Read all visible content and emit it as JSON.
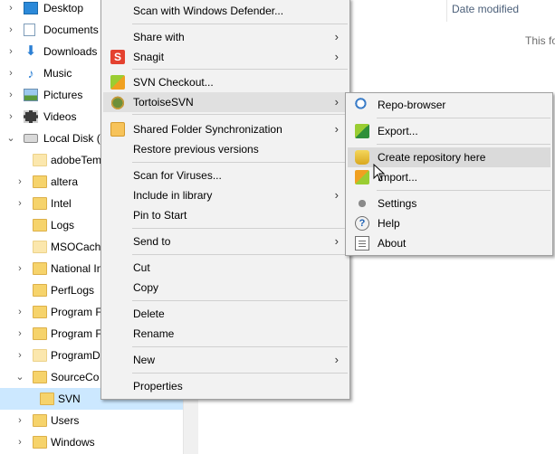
{
  "nav_tree": {
    "items": [
      {
        "label": "Desktop",
        "icon": "desktop-icon",
        "chevron": "›",
        "indent": 0
      },
      {
        "label": "Documents",
        "icon": "documents-icon",
        "chevron": "›",
        "indent": 0
      },
      {
        "label": "Downloads",
        "icon": "downloads-icon",
        "chevron": "›",
        "indent": 0
      },
      {
        "label": "Music",
        "icon": "music-icon",
        "chevron": "›",
        "indent": 0
      },
      {
        "label": "Pictures",
        "icon": "pictures-icon",
        "chevron": "›",
        "indent": 0
      },
      {
        "label": "Videos",
        "icon": "videos-icon",
        "chevron": "›",
        "indent": 0
      },
      {
        "label": "Local Disk (C",
        "icon": "drive-icon",
        "chevron": "⌄",
        "indent": 0
      },
      {
        "label": "adobeTem",
        "icon": "folder-icon",
        "chevron": "",
        "indent": 1
      },
      {
        "label": "altera",
        "icon": "folder-icon",
        "chevron": "›",
        "indent": 1
      },
      {
        "label": "Intel",
        "icon": "folder-icon",
        "chevron": "›",
        "indent": 1
      },
      {
        "label": "Logs",
        "icon": "folder-icon",
        "chevron": "",
        "indent": 1
      },
      {
        "label": "MSOCache",
        "icon": "folder-icon",
        "chevron": "",
        "indent": 1
      },
      {
        "label": "National In",
        "icon": "folder-icon",
        "chevron": "›",
        "indent": 1
      },
      {
        "label": "PerfLogs",
        "icon": "folder-icon",
        "chevron": "",
        "indent": 1
      },
      {
        "label": "Program F",
        "icon": "folder-icon",
        "chevron": "›",
        "indent": 1
      },
      {
        "label": "Program F",
        "icon": "folder-icon",
        "chevron": "›",
        "indent": 1
      },
      {
        "label": "ProgramD",
        "icon": "folder-icon",
        "chevron": "›",
        "indent": 1
      },
      {
        "label": "SourceCo",
        "icon": "folder-icon",
        "chevron": "⌄",
        "indent": 1
      },
      {
        "label": "SVN",
        "icon": "folder-icon",
        "chevron": "",
        "indent": 2
      },
      {
        "label": "Users",
        "icon": "folder-icon",
        "chevron": "›",
        "indent": 1
      },
      {
        "label": "Windows",
        "icon": "folder-icon",
        "chevron": "›",
        "indent": 1
      }
    ]
  },
  "details": {
    "column_date_modified": "Date modified",
    "empty_message": "This fo"
  },
  "context_menu": {
    "scan_defender": "Scan with Windows Defender...",
    "share_with": "Share with",
    "snagit": "Snagit",
    "svn_checkout": "SVN Checkout...",
    "tortoisesvn": "TortoiseSVN",
    "shared_folder_sync": "Shared Folder Synchronization",
    "restore_versions": "Restore previous versions",
    "scan_viruses": "Scan for Viruses...",
    "include_library": "Include in library",
    "pin_start": "Pin to Start",
    "send_to": "Send to",
    "cut": "Cut",
    "copy": "Copy",
    "delete": "Delete",
    "rename": "Rename",
    "new": "New",
    "properties": "Properties",
    "snagit_glyph": "S"
  },
  "submenu": {
    "repo_browser": "Repo-browser",
    "export": "Export...",
    "create_repo": "Create repository here",
    "import": "Import...",
    "settings": "Settings",
    "help": "Help",
    "about": "About",
    "help_glyph": "?"
  },
  "arrow_glyph": "›"
}
